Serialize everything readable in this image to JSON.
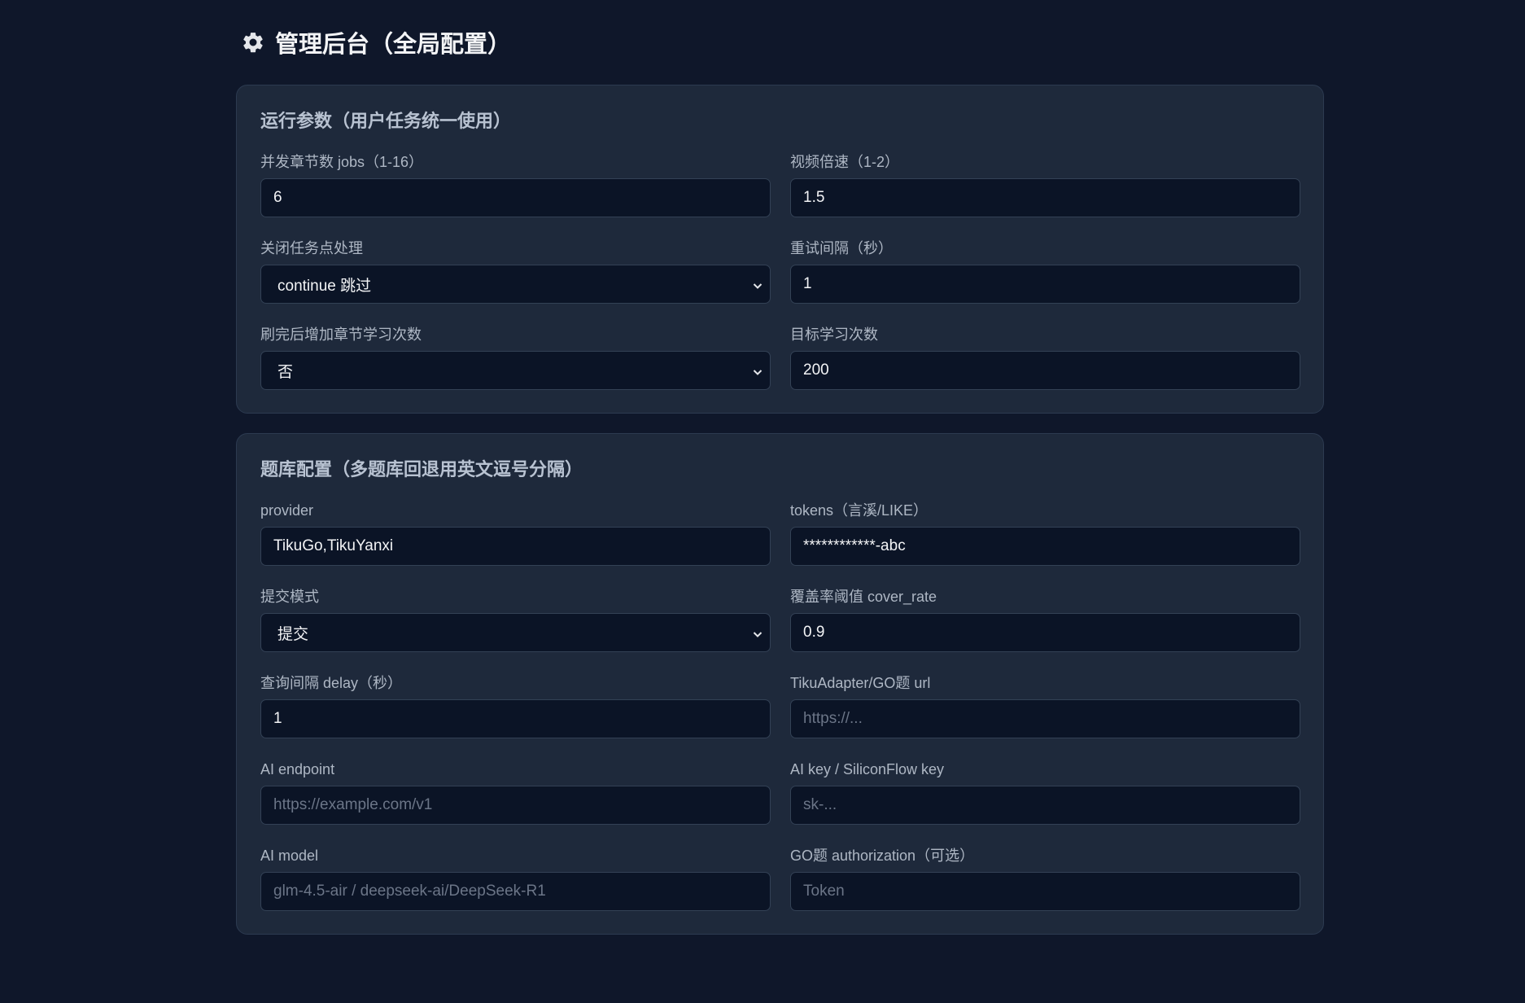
{
  "header": {
    "title": "管理后台（全局配置）",
    "icon": "gear-icon"
  },
  "run_params": {
    "title": "运行参数（用户任务统一使用）",
    "fields": [
      {
        "label": "并发章节数 jobs（1-16）",
        "value": "6"
      },
      {
        "label": "视频倍速（1-2）",
        "value": "1.5"
      },
      {
        "label": "关闭任务点处理",
        "value": "continue 跳过"
      },
      {
        "label": "重试间隔（秒）",
        "value": "1"
      },
      {
        "label": "刷完后增加章节学习次数",
        "value": "否"
      },
      {
        "label": "目标学习次数",
        "value": "200"
      }
    ]
  },
  "tiku": {
    "title": "题库配置（多题库回退用英文逗号分隔）",
    "fields": [
      {
        "label": "provider",
        "value": "TikuGo,TikuYanxi"
      },
      {
        "label": "tokens（言溪/LIKE）",
        "value": "************-abc"
      },
      {
        "label": "提交模式",
        "value": "提交"
      },
      {
        "label": "覆盖率阈值 cover_rate",
        "value": "0.9"
      },
      {
        "label": "查询间隔 delay（秒）",
        "value": "1"
      },
      {
        "label": "TikuAdapter/GO题 url",
        "placeholder": "https://..."
      },
      {
        "label": "AI endpoint",
        "placeholder": "https://example.com/v1"
      },
      {
        "label": "AI key / SiliconFlow key",
        "placeholder": "sk-..."
      },
      {
        "label": "AI model",
        "placeholder": "glm-4.5-air / deepseek-ai/DeepSeek-R1"
      },
      {
        "label": "GO题 authorization（可选）",
        "placeholder": "Token"
      }
    ]
  }
}
